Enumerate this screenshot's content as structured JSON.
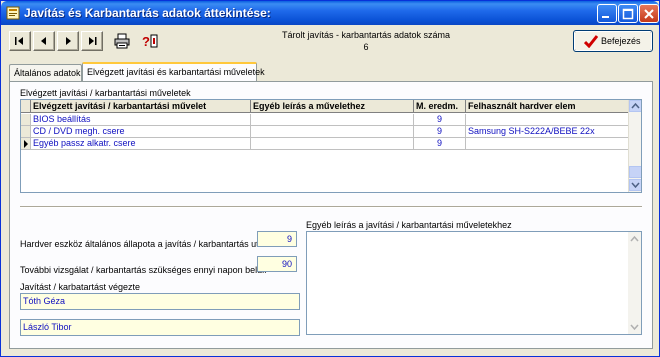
{
  "window": {
    "title": "Javítás és Karbantartás adatok áttekintése:"
  },
  "toolbar": {
    "count_label": "Tárolt javítás - karbantartás adatok száma",
    "count_value": "6",
    "finish_label": "Befejezés"
  },
  "tabs": [
    {
      "label": "Általános adatok",
      "active": false
    },
    {
      "label": "Elvégzett javítási és karbantartási műveletek",
      "active": true
    }
  ],
  "grid": {
    "caption": "Elvégzett javítási / karbantartási műveletek",
    "columns": [
      "Elvégzett javítási / karbantartási művelet",
      "Egyéb leírás a művelethez",
      "M. eredm.",
      "Felhasznált hardver elem"
    ],
    "rows": [
      {
        "op": "BIOS beállítás",
        "desc": "",
        "result": "9",
        "hw": ""
      },
      {
        "op": "CD / DVD megh. csere",
        "desc": "",
        "result": "9",
        "hw": "Samsung SH-S222A/BEBE 22x"
      },
      {
        "op": "Egyéb passz alkatr. csere",
        "desc": "",
        "result": "9",
        "hw": ""
      }
    ]
  },
  "form": {
    "state_label": "Hardver eszköz általános állapota a javítás / karbantartás után:",
    "state_value": "9",
    "next_label": "További vizsgálat / karbantartás szükséges ennyi napon belül:",
    "next_value": "90",
    "performer_label": "Javítást / karbatartást végezte",
    "performer1": "Tóth Géza",
    "performer2": "László Tibor",
    "notes_label": "Egyéb leírás a javítási / karbantartási műveletekhez",
    "notes_value": ""
  },
  "colors": {
    "title_bar": "#0B52D6",
    "value_text": "#1010C0",
    "input_bg": "#FFFFE1",
    "tab_highlight": "#FFC83C"
  }
}
